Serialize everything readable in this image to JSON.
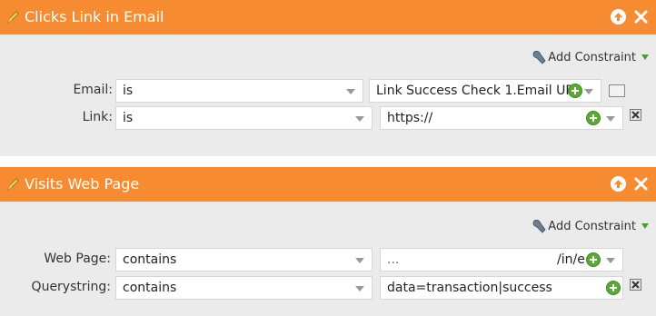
{
  "panels": [
    {
      "title": "Clicks Link in Email",
      "add_constraint": "Add Constraint",
      "rows": [
        {
          "label": "Email:",
          "operator": "is",
          "value": "Link Success Check 1.Email URL"
        },
        {
          "label": "Link:",
          "operator": "is",
          "value": "https://"
        }
      ]
    },
    {
      "title": "Visits Web Page",
      "add_constraint": "Add Constraint",
      "rows": [
        {
          "label": "Web Page:",
          "operator": "contains",
          "value": "/in/e",
          "value_blurred_prefix": "..."
        },
        {
          "label": "Querystring:",
          "operator": "contains",
          "value": "data=transaction|success"
        }
      ]
    }
  ],
  "colors": {
    "header": "#f68b31",
    "panel_bg": "#ebebeb",
    "plus": "#5aa936"
  },
  "icons": [
    "pencil-icon",
    "arrow-up-icon",
    "close-icon",
    "wrench-icon",
    "plus-icon",
    "lookup-icon",
    "remove-icon"
  ]
}
